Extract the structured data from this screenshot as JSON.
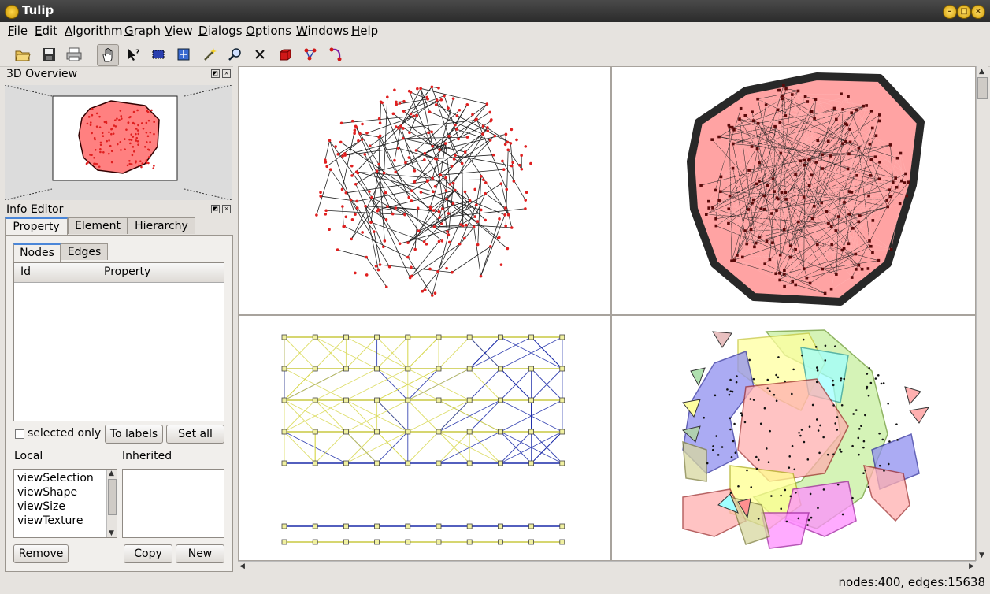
{
  "window": {
    "title": "Tulip"
  },
  "menu": [
    {
      "label": "File",
      "accel": "F"
    },
    {
      "label": "Edit",
      "accel": "E"
    },
    {
      "label": "Algorithm",
      "accel": "A"
    },
    {
      "label": "Graph",
      "accel": "G"
    },
    {
      "label": "View",
      "accel": "V"
    },
    {
      "label": "Dialogs",
      "accel": "D"
    },
    {
      "label": "Options",
      "accel": "O"
    },
    {
      "label": "Windows",
      "accel": "W"
    },
    {
      "label": "Help",
      "accel": "H"
    }
  ],
  "toolbar": {
    "icons": [
      "open-folder-icon",
      "save-icon",
      "print-icon",
      "hand-navigate-icon",
      "select-pointer-icon",
      "rectangle-select-icon",
      "zoom-box-icon",
      "magic-wand-icon",
      "magnifier-icon",
      "delete-icon",
      "add-node-icon",
      "add-edge-icon",
      "bend-edge-icon"
    ],
    "active": "hand-navigate-icon"
  },
  "overview": {
    "title": "3D Overview"
  },
  "info_editor": {
    "title": "Info Editor",
    "tabs": [
      "Property",
      "Element",
      "Hierarchy"
    ],
    "selected_tab": "Property",
    "subtabs": [
      "Nodes",
      "Edges"
    ],
    "selected_subtab": "Nodes",
    "table_headers": [
      "Id",
      "Property"
    ],
    "selected_only_label": "selected only",
    "to_labels": "To labels",
    "set_all": "Set all",
    "local_label": "Local",
    "inherited_label": "Inherited",
    "local_items": [
      "viewSelection",
      "viewShape",
      "viewSize",
      "viewTexture"
    ],
    "remove": "Remove",
    "copy": "Copy",
    "new": "New"
  },
  "status": {
    "text": "nodes:400, edges:15638"
  },
  "colors": {
    "node_red": "#e02020",
    "edge_dark": "#222222",
    "edge_pink": "#ff9a9a",
    "edge_yellow": "#e8e87a",
    "edge_blue": "#1a2aa8",
    "node_yellow": "#f0f0a0"
  }
}
